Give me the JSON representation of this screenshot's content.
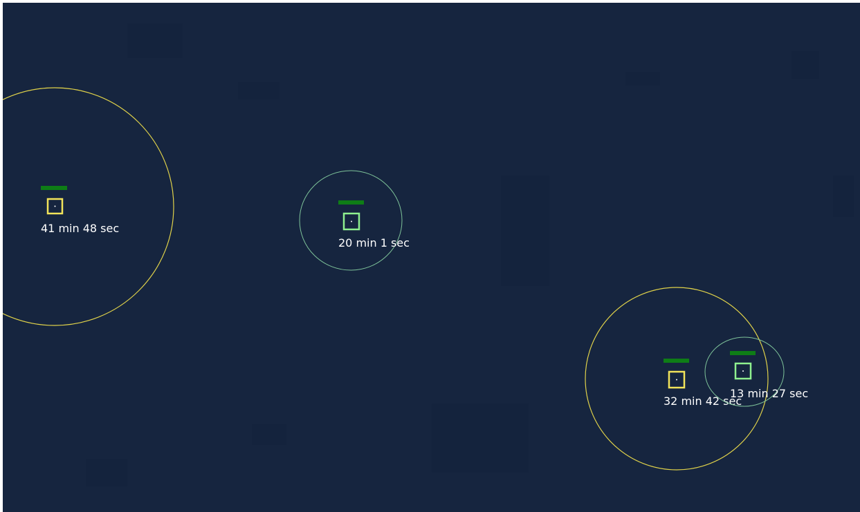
{
  "map": {
    "background_color": "#16253f"
  },
  "markers": [
    {
      "label": "41 min 48 sec",
      "status": "yellow",
      "color": "#e0d24a",
      "box_color": "#f2e45a",
      "bar_color": "#0e7d16"
    },
    {
      "label": "20 min 1 sec",
      "status": "green",
      "color": "#7fc49a",
      "box_color": "#8ff08f",
      "bar_color": "#0e7d16"
    },
    {
      "label": "32 min 42 sec",
      "status": "yellow",
      "color": "#e0d24a",
      "box_color": "#f2e45a",
      "bar_color": "#0e7d16"
    },
    {
      "label": "13 min 27 sec",
      "status": "green",
      "color": "#7fc49a",
      "box_color": "#8ff08f",
      "bar_color": "#0e7d16"
    }
  ]
}
